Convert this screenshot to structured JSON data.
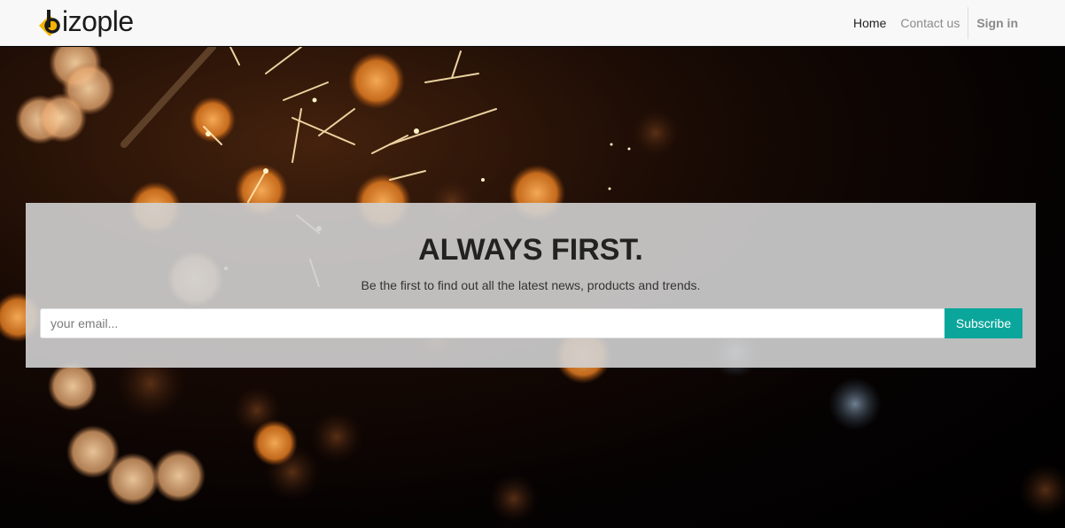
{
  "brand": {
    "name": "izople",
    "accent_color": "#f5b400"
  },
  "nav": {
    "home": "Home",
    "contact": "Contact us",
    "signin": "Sign in"
  },
  "hero": {
    "title": "ALWAYS FIRST.",
    "subtitle": "Be the first to find out all the latest news, products and trends.",
    "email_placeholder": "your email...",
    "subscribe_label": "Subscribe",
    "button_color": "#0aa69b"
  }
}
